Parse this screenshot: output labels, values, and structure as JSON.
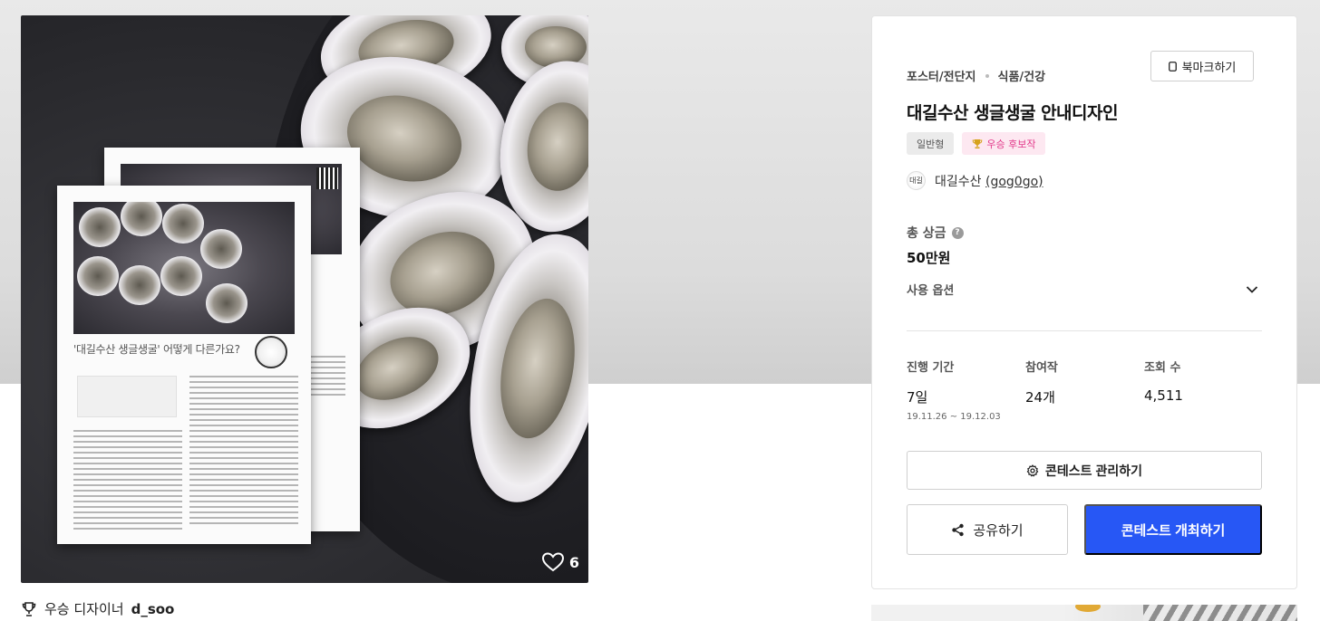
{
  "hero": {
    "poster_headline": "'대길수산 생글생굴' 어떻게 다른가요?",
    "like_count": "6"
  },
  "winner": {
    "prefix": "우승 디자이너",
    "designer": "d_soo"
  },
  "panel": {
    "breadcrumb": [
      "포스터/전단지",
      "식품/건강"
    ],
    "bookmark_label": "북마크하기",
    "title": "대길수산 생글생굴 안내디자인",
    "tags": {
      "type": "일반형",
      "status": "우승 후보작"
    },
    "owner": {
      "avatar_text": "대길",
      "name": "대길수산",
      "handle": "(gog0go)"
    },
    "prize_label": "총 상금",
    "prize_help": "?",
    "prize_value": "50만원",
    "options_label": "사용 옵션",
    "stats": {
      "duration_label": "진행 기간",
      "duration_value": "7일",
      "duration_range": "19.11.26 ~ 19.12.03",
      "entries_label": "참여작",
      "entries_value": "24개",
      "views_label": "조회 수",
      "views_value": "4,511"
    },
    "manage_label": "콘테스트 관리하기",
    "share_label": "공유하기",
    "host_label": "콘테스트 개최하기"
  },
  "colors": {
    "primary": "#2757f5",
    "badge_pink_bg": "#fde8f1",
    "badge_pink_text": "#e2388a",
    "badge_gray_bg": "#ebebeb"
  },
  "icons": [
    "heart-icon",
    "trophy-icon",
    "bookmark-icon",
    "help-icon",
    "chevron-down-icon",
    "gear-icon",
    "share-icon"
  ]
}
